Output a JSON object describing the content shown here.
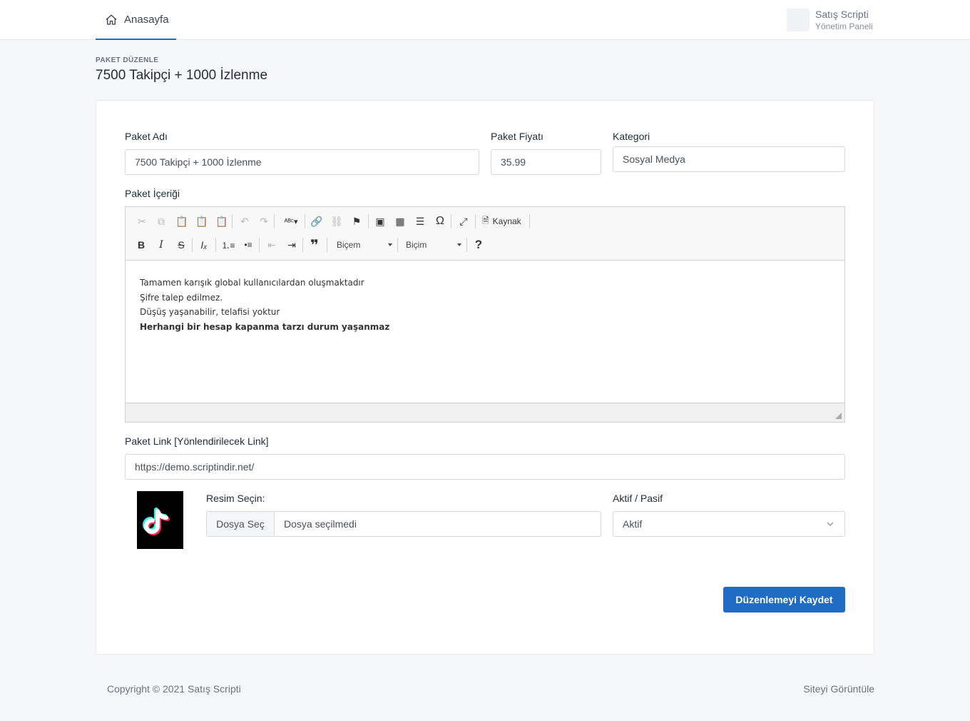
{
  "nav": {
    "home_label": "Anasayfa",
    "brand_name": "Satış Scripti",
    "brand_subtitle": "Yönetim Paneli"
  },
  "header": {
    "pretitle": "PAKET DÜZENLE",
    "title": "7500 Takipçi + 1000 İzlenme"
  },
  "form": {
    "name_label": "Paket Adı",
    "name_value": "7500 Takipçi + 1000 İzlenme",
    "price_label": "Paket Fiyatı",
    "price_value": "35.99",
    "category_label": "Kategori",
    "category_value": "Sosyal Medya",
    "content_label": "Paket İçeriği",
    "link_label": "Paket Link [Yönlendirilecek Link]",
    "link_value": "https://demo.scriptindir.net/",
    "image_label": "Resim Seçin:",
    "file_button": "Dosya Seç",
    "file_status": "Dosya seçilmedi",
    "status_label": "Aktif / Pasif",
    "status_value": "Aktif",
    "save_button": "Düzenlemeyi Kaydet"
  },
  "editor": {
    "source_label": "Kaynak",
    "format_combo_1": "Biçem",
    "format_combo_2": "Biçim",
    "lines": [
      "Tamamen karışık global kullanıcılardan oluşmaktadır",
      "Şifre talep edilmez.",
      "Düşüş yaşanabilir, telafisi yoktur",
      "Herhangi bir hesap kapanma tarzı durum yaşanmaz"
    ]
  },
  "footer": {
    "copyright": "Copyright © 2021 Satış Scripti",
    "view_site": "Siteyi Görüntüle"
  },
  "colors": {
    "primary": "#206bc4",
    "background": "#f5f7fb"
  }
}
